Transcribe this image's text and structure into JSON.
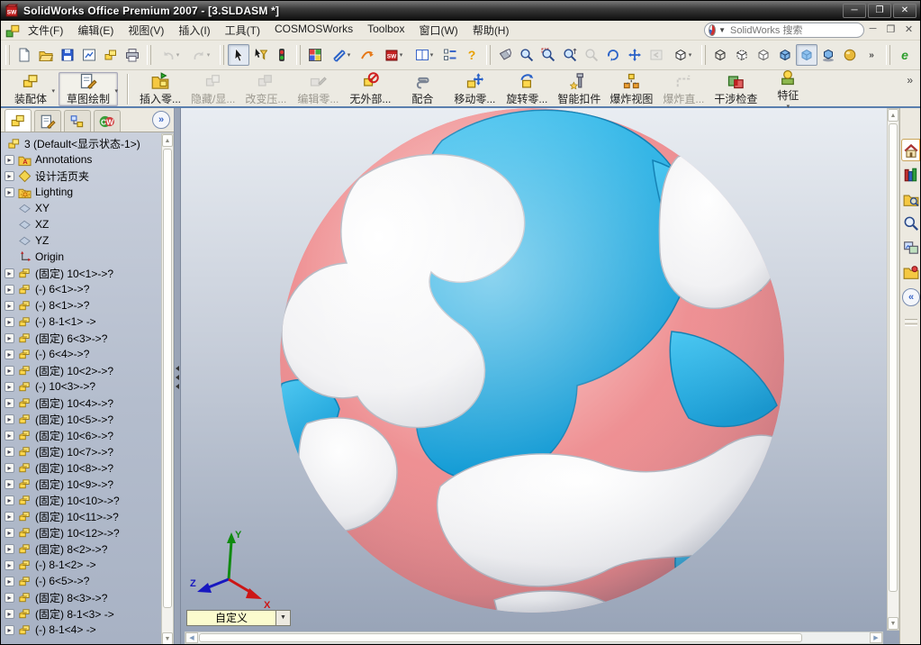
{
  "window": {
    "title": "SolidWorks Office Premium 2007 - [3.SLDASM *]",
    "controls": [
      "minimize",
      "restore",
      "close"
    ]
  },
  "menu": {
    "items": [
      {
        "id": "file",
        "label": "文件(F)"
      },
      {
        "id": "edit",
        "label": "编辑(E)"
      },
      {
        "id": "view",
        "label": "视图(V)"
      },
      {
        "id": "insert",
        "label": "插入(I)"
      },
      {
        "id": "tools",
        "label": "工具(T)"
      },
      {
        "id": "cosmosworks",
        "label": "COSMOSWorks"
      },
      {
        "id": "toolbox",
        "label": "Toolbox"
      },
      {
        "id": "window",
        "label": "窗口(W)"
      },
      {
        "id": "help",
        "label": "帮助(H)"
      }
    ],
    "search_placeholder": "SolidWorks 搜索"
  },
  "toolbar_main": {
    "groups": [
      [
        {
          "name": "new"
        },
        {
          "name": "open"
        },
        {
          "name": "save"
        },
        {
          "name": "make-drawing"
        },
        {
          "name": "make-assembly"
        },
        {
          "name": "print"
        }
      ],
      [
        {
          "name": "undo",
          "enabled": false,
          "dropdown": true
        },
        {
          "name": "redo",
          "enabled": false,
          "dropdown": true
        }
      ],
      [
        {
          "name": "select",
          "pressed": true
        },
        {
          "name": "select-filter"
        },
        {
          "name": "stoplight"
        }
      ],
      [
        {
          "name": "edit-color"
        },
        {
          "name": "measure",
          "dropdown": true
        },
        {
          "name": "cosmosxpress"
        },
        {
          "name": "sw-resources",
          "dropdown": true
        },
        {
          "name": "split-window",
          "dropdown": true
        },
        {
          "name": "options"
        },
        {
          "name": "help"
        }
      ],
      [
        {
          "name": "view-orientation"
        },
        {
          "name": "zoom-fit"
        },
        {
          "name": "zoom-area"
        },
        {
          "name": "zoom-in-out"
        },
        {
          "name": "zoom-selection",
          "enabled": false
        },
        {
          "name": "rotate-view"
        },
        {
          "name": "pan"
        },
        {
          "name": "previous-view",
          "enabled": false
        },
        {
          "name": "standard-views",
          "dropdown": true
        }
      ],
      [
        {
          "name": "wireframe"
        },
        {
          "name": "hidden-lines-visible"
        },
        {
          "name": "hidden-lines-removed"
        },
        {
          "name": "shaded-with-edges"
        },
        {
          "name": "shaded",
          "pressed": true
        },
        {
          "name": "shadows"
        },
        {
          "name": "realview"
        },
        {
          "name": "toolbar-overflow"
        }
      ],
      [
        {
          "name": "edrawings"
        },
        {
          "name": "toolbar-overflow"
        }
      ]
    ]
  },
  "command_manager": {
    "tabs": [
      {
        "label": "装配体",
        "dropdown": true,
        "active": false
      },
      {
        "label": "草图绘制",
        "dropdown": true,
        "active": true
      }
    ],
    "buttons": [
      {
        "icon": "insert-component",
        "label": "插入零...",
        "enabled": true
      },
      {
        "icon": "hide-show",
        "label": "隐藏/显...",
        "enabled": false
      },
      {
        "icon": "change-suppression",
        "label": "改变压...",
        "enabled": false
      },
      {
        "icon": "edit-component",
        "label": "编辑零...",
        "enabled": false
      },
      {
        "icon": "no-external-ref",
        "label": "无外部...",
        "enabled": true
      },
      {
        "icon": "mate",
        "label": "配合",
        "enabled": true
      },
      {
        "icon": "move-component",
        "label": "移动零...",
        "enabled": true
      },
      {
        "icon": "rotate-component",
        "label": "旋转零...",
        "enabled": true
      },
      {
        "icon": "smart-fasteners",
        "label": "智能扣件",
        "enabled": true
      },
      {
        "icon": "exploded-view",
        "label": "爆炸视图",
        "enabled": true
      },
      {
        "icon": "explode-line",
        "label": "爆炸直...",
        "enabled": false
      },
      {
        "icon": "interference-detection",
        "label": "干涉检查",
        "enabled": true
      },
      {
        "icon": "features",
        "label": "特征",
        "enabled": true,
        "dropdown": true
      }
    ],
    "overflow": "»"
  },
  "feature_panel": {
    "tabs": [
      "featuremanager",
      "propertymanager",
      "configurationmanager",
      "cosmosworks-manager"
    ],
    "expand_chevron": "»",
    "tree": [
      {
        "icon": "assembly",
        "label": "3 (Default<显示状态-1>)",
        "root": true
      },
      {
        "icon": "annotations",
        "label": "Annotations",
        "expandable": true
      },
      {
        "icon": "binder",
        "label": "设计活页夹",
        "expandable": true
      },
      {
        "icon": "lighting",
        "label": "Lighting",
        "expandable": true
      },
      {
        "icon": "plane",
        "label": "XY"
      },
      {
        "icon": "plane",
        "label": "XZ"
      },
      {
        "icon": "plane",
        "label": "YZ"
      },
      {
        "icon": "origin",
        "label": "Origin"
      },
      {
        "icon": "component",
        "label": "(固定) 10<1>->?",
        "expandable": true
      },
      {
        "icon": "component",
        "label": "(-) 6<1>->?",
        "expandable": true
      },
      {
        "icon": "component",
        "label": "(-) 8<1>->?",
        "expandable": true
      },
      {
        "icon": "component",
        "label": "(-) 8-1<1> ->",
        "expandable": true
      },
      {
        "icon": "component",
        "label": "(固定) 6<3>->?",
        "expandable": true
      },
      {
        "icon": "component",
        "label": "(-) 6<4>->?",
        "expandable": true
      },
      {
        "icon": "component",
        "label": "(固定) 10<2>->?",
        "expandable": true
      },
      {
        "icon": "component",
        "label": "(-) 10<3>->?",
        "expandable": true
      },
      {
        "icon": "component",
        "label": "(固定) 10<4>->?",
        "expandable": true
      },
      {
        "icon": "component",
        "label": "(固定) 10<5>->?",
        "expandable": true
      },
      {
        "icon": "component",
        "label": "(固定) 10<6>->?",
        "expandable": true
      },
      {
        "icon": "component",
        "label": "(固定) 10<7>->?",
        "expandable": true
      },
      {
        "icon": "component",
        "label": "(固定) 10<8>->?",
        "expandable": true
      },
      {
        "icon": "component",
        "label": "(固定) 10<9>->?",
        "expandable": true
      },
      {
        "icon": "component",
        "label": "(固定) 10<10>->?",
        "expandable": true
      },
      {
        "icon": "component",
        "label": "(固定) 10<11>->?",
        "expandable": true
      },
      {
        "icon": "component",
        "label": "(固定) 10<12>->?",
        "expandable": true
      },
      {
        "icon": "component",
        "label": "(固定) 8<2>->?",
        "expandable": true
      },
      {
        "icon": "component",
        "label": "(-) 8-1<2> ->",
        "expandable": true
      },
      {
        "icon": "component",
        "label": "(-) 6<5>->?",
        "expandable": true
      },
      {
        "icon": "component",
        "label": "(固定) 8<3>->?",
        "expandable": true
      },
      {
        "icon": "component",
        "label": "(固定) 8-1<3> ->",
        "expandable": true
      },
      {
        "icon": "component",
        "label": "(-) 8-1<4> ->",
        "expandable": true
      }
    ]
  },
  "viewport": {
    "combo_value": "自定义",
    "triad": {
      "x": "X",
      "y": "Y",
      "z": "Z"
    },
    "model": {
      "description": "soccer ball assembly (Teamgeist-style swirl panels)",
      "panel_colors": {
        "pink": "#ee8f90",
        "cyan": "#29b2e8",
        "white": "#f4f4f6"
      }
    }
  },
  "task_pane": {
    "icons": [
      {
        "name": "home",
        "active": true
      },
      {
        "name": "solidworks-resources"
      },
      {
        "name": "design-library"
      },
      {
        "name": "search"
      },
      {
        "name": "view-palette"
      },
      {
        "name": "file-explorer"
      }
    ],
    "collapse": "«"
  },
  "colors": {
    "titlebar": "#1b1b1b",
    "toolbar_bg": "#eceae2",
    "viewport_top": "#e9edf2",
    "viewport_bottom": "#96a2b6",
    "accent_blue": "#5a7fae"
  }
}
